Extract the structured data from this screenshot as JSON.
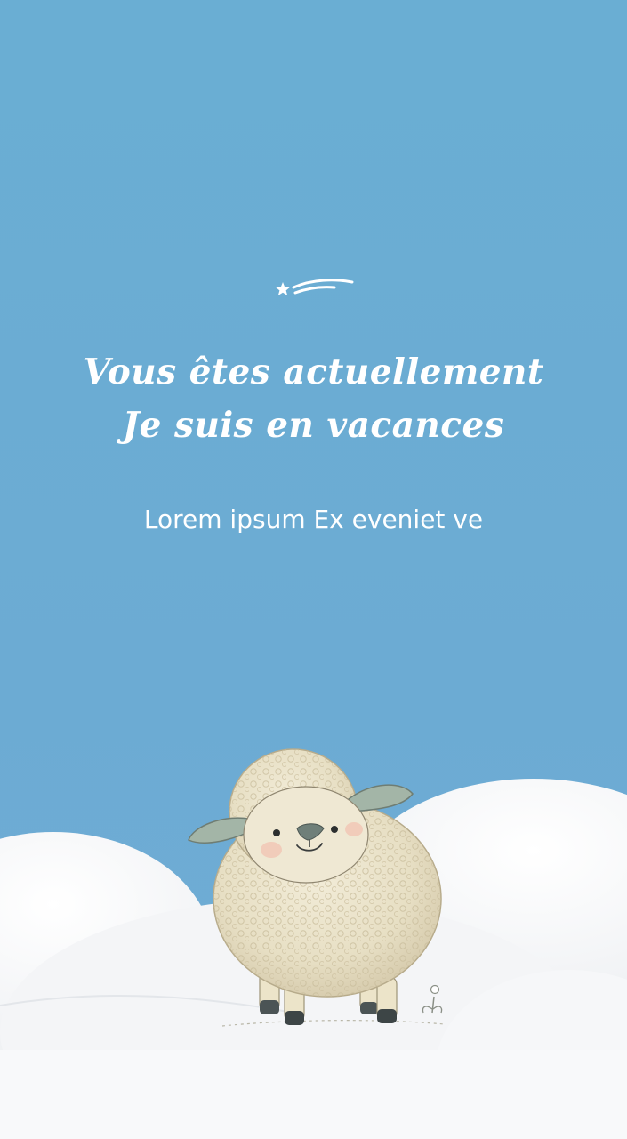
{
  "screen": {
    "title_line_1": "Vous êtes actuellement",
    "title_line_2": "Je suis en vacances",
    "subtitle": "Lorem ipsum Ex eveniet ve"
  },
  "decorations": {
    "top_icon": "shooting-star-icon",
    "illustration": "sheep-on-clouds"
  },
  "colors": {
    "sky": "#6cabd3",
    "text": "#ffffff",
    "cloud": "#f7f8fa",
    "wool": "#ece6d0",
    "ear": "#9db1a3"
  }
}
